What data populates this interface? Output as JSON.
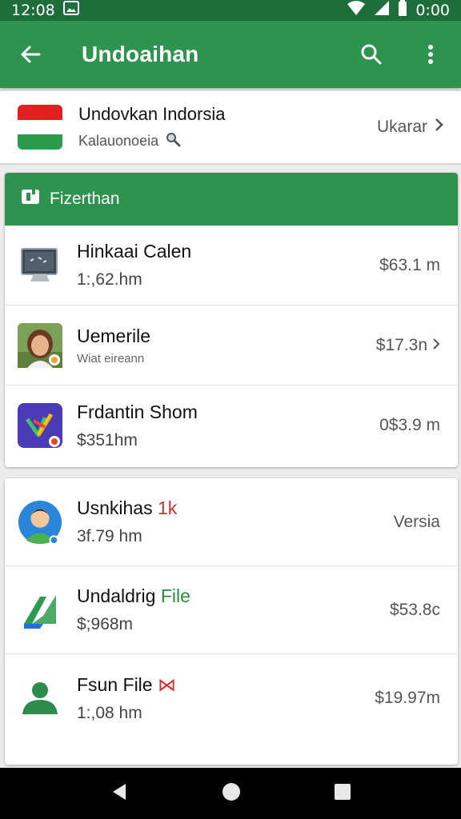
{
  "status_bar": {
    "time": "12:08",
    "right_time": "0:00"
  },
  "app_bar": {
    "title": "Undoaihan"
  },
  "country": {
    "name": "Undovkan Indorsia",
    "sub": "Kalauonoeia",
    "action": "Ukarar"
  },
  "card1": {
    "header": "Fizerthan",
    "items": [
      {
        "title": "Hinkaai Calen",
        "subtitle": "1:,62.hm",
        "value": "$63.1 m",
        "icon": "monitor-icon"
      },
      {
        "title": "Uemerile",
        "subtitle": "Wiat eireann",
        "value": "$17.3n",
        "icon": "person-photo"
      },
      {
        "title": "Frdantin Shom",
        "subtitle": "$351hm",
        "value": "0$3.9 m",
        "icon": "app-logo-icon"
      }
    ]
  },
  "card2": {
    "items": [
      {
        "title": "Usnkihas",
        "tag": "1k",
        "subtitle": "3f.79 hm",
        "value": "Versia",
        "icon": "avatar-icon"
      },
      {
        "title": "Undaldrig",
        "tag": "File",
        "subtitle": "$;968m",
        "value": "$53.8c",
        "icon": "drive-icon"
      },
      {
        "title": "Fsun File",
        "tag": "⋈",
        "subtitle": "1:,08 hm",
        "value": "$19.97m",
        "icon": "person-icon"
      }
    ]
  },
  "colors": {
    "primary": "#2f9350",
    "status_bar": "#1e6e3c",
    "accent_red": "#d32f2f"
  }
}
